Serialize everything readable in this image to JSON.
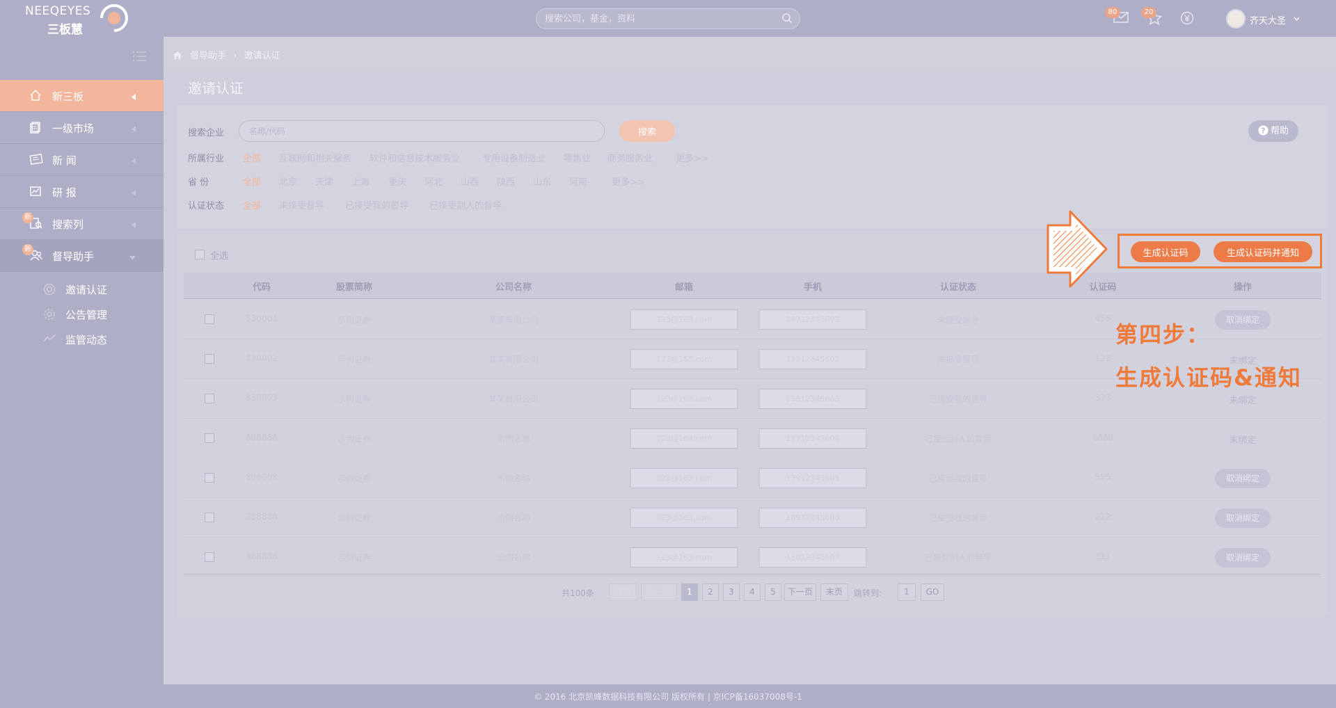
{
  "header": {
    "logo_text": "NEEQEYES",
    "logo_sub": "三板慧",
    "search_placeholder": "搜索公司，基金，资料",
    "mail_count": "80",
    "star_count": "20",
    "username": "齐天大圣"
  },
  "sidebar": {
    "items": [
      {
        "label": "新三板",
        "icon": "home-icon",
        "state": "active",
        "new": false
      },
      {
        "label": "一级市场",
        "icon": "book-icon",
        "state": "",
        "new": false
      },
      {
        "label": "新  闻",
        "icon": "news-icon",
        "state": "",
        "new": false
      },
      {
        "label": "研  报",
        "icon": "chart-icon",
        "state": "",
        "new": false
      },
      {
        "label": "搜索列",
        "icon": "search-list-icon",
        "state": "",
        "new": true
      },
      {
        "label": "督导助手",
        "icon": "users-icon",
        "state": "open",
        "new": true
      }
    ],
    "new_tag": "新",
    "sub_items": [
      {
        "label": "邀请认证",
        "icon": "invite-icon"
      },
      {
        "label": "公告管理",
        "icon": "gear-icon"
      },
      {
        "label": "监管动态",
        "icon": "trend-icon"
      }
    ]
  },
  "breadcrumb": [
    "督导助手",
    "›",
    "邀请认证"
  ],
  "page_title": "邀请认证",
  "filters": {
    "search_label": "搜索企业",
    "search_placeholder": "名称/代码",
    "search_button": "搜索",
    "help_button": "帮助",
    "industry_label": "所属行业",
    "industry_options": [
      "全部",
      "互联网和相关服务",
      "软件和信息技术服务业",
      "专用设备制造业",
      "零售业",
      "商务服务业",
      "更多>>"
    ],
    "province_label": "省    份",
    "province_options": [
      "全部",
      "北京",
      "天津",
      "上海",
      "重庆",
      "河北",
      "山西",
      "陕西",
      "山东",
      "河南",
      "更多>>"
    ],
    "status_label": "认证状态",
    "status_options": [
      "全部",
      "未接受督导",
      "已接受我的督导",
      "已接受别人的督导"
    ]
  },
  "table": {
    "select_all": "全选",
    "columns": [
      "代码",
      "股票简称",
      "公司名称",
      "邮箱",
      "手机",
      "认证状态",
      "认证码",
      "操作"
    ],
    "rows": [
      {
        "code": "830001",
        "short": "示例证券",
        "company": "某某有限公司",
        "email": "123@163.com",
        "phone": "18712345601",
        "status": "未接受督导",
        "auth": "456",
        "action": "取消绑定",
        "action_type": "button"
      },
      {
        "code": "830002",
        "short": "示例证券",
        "company": "某某有限公司",
        "email": "123@163.com",
        "phone": "13512345602",
        "status": "未接受督导",
        "auth": "123",
        "action": "未绑定",
        "action_type": "text"
      },
      {
        "code": "830003",
        "short": "示例证券",
        "company": "某某有限公司",
        "email": "123@163.com",
        "phone": "13812345603",
        "status": "已接受我的督导",
        "auth": "333",
        "action": "未绑定",
        "action_type": "text"
      },
      {
        "code": "888888",
        "short": "示例证券",
        "company": "示例名称",
        "email": "123@163.com",
        "phone": "17712345604",
        "status": "已接受别人的督导",
        "auth": "8888",
        "action": "未绑定",
        "action_type": "text"
      },
      {
        "code": "888888",
        "short": "示例证券",
        "company": "示例名称",
        "email": "123@163.com",
        "phone": "13912345605",
        "status": "已接受我的督导",
        "auth": "555",
        "action": "取消绑定",
        "action_type": "button"
      },
      {
        "code": "888888",
        "short": "示例证券",
        "company": "示例名称",
        "email": "123@163.com",
        "phone": "18912345606",
        "status": "已接受我的督导",
        "auth": "222",
        "action": "取消绑定",
        "action_type": "button"
      },
      {
        "code": "888888",
        "short": "示例证券",
        "company": "示例名称",
        "email": "123@163.com",
        "phone": "13012345607",
        "status": "已接受别人的督导",
        "auth": "111",
        "action": "取消绑定",
        "action_type": "button"
      }
    ]
  },
  "pagination": {
    "total": "共100条",
    "first": "首页",
    "prev": "上一页",
    "pages": [
      "1",
      "2",
      "3",
      "4",
      "5"
    ],
    "next": "下一页",
    "last": "末页",
    "jump_label": "跳转到:",
    "jump_value": "1",
    "go": "GO"
  },
  "annotation": {
    "btn_generate": "生成认证码",
    "btn_generate_notify": "生成认证码并通知",
    "step_title": "第四步：",
    "step_desc": "生成认证码&通知",
    "accent_color": "#ef7a3a"
  },
  "footer": "© 2016 北京凯峰数据科技有限公司 版权所有 | 京ICP备16037008号-1"
}
